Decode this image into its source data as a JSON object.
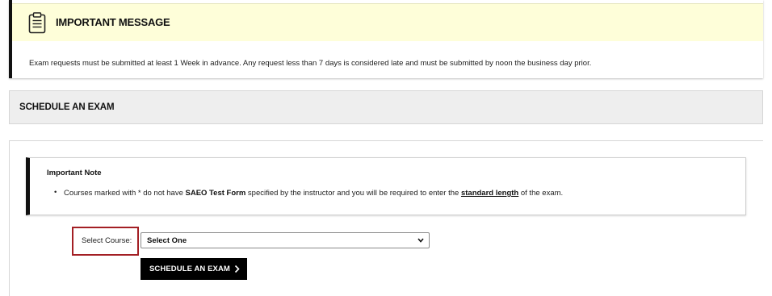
{
  "message": {
    "icon": "clipboard-icon",
    "title": "IMPORTANT MESSAGE",
    "body": "Exam requests must be submitted at least 1 Week in advance. Any request less than 7 days is considered late and must be submitted by noon the business day prior."
  },
  "schedule": {
    "title": "SCHEDULE AN EXAM"
  },
  "note": {
    "title": "Important Note",
    "item_prefix": "Courses marked with * do not have ",
    "item_bold": "SAEO Test Form",
    "item_middle": " specified by the instructor and you will be required to enter the ",
    "item_link": "standard length",
    "item_suffix": " of the exam."
  },
  "form": {
    "select_label": "Select Course:",
    "select_value": "Select One",
    "button_label": "SCHEDULE AN EXAM",
    "button_icon": "chevron-right-icon",
    "highlight_color": "#a31f24"
  }
}
